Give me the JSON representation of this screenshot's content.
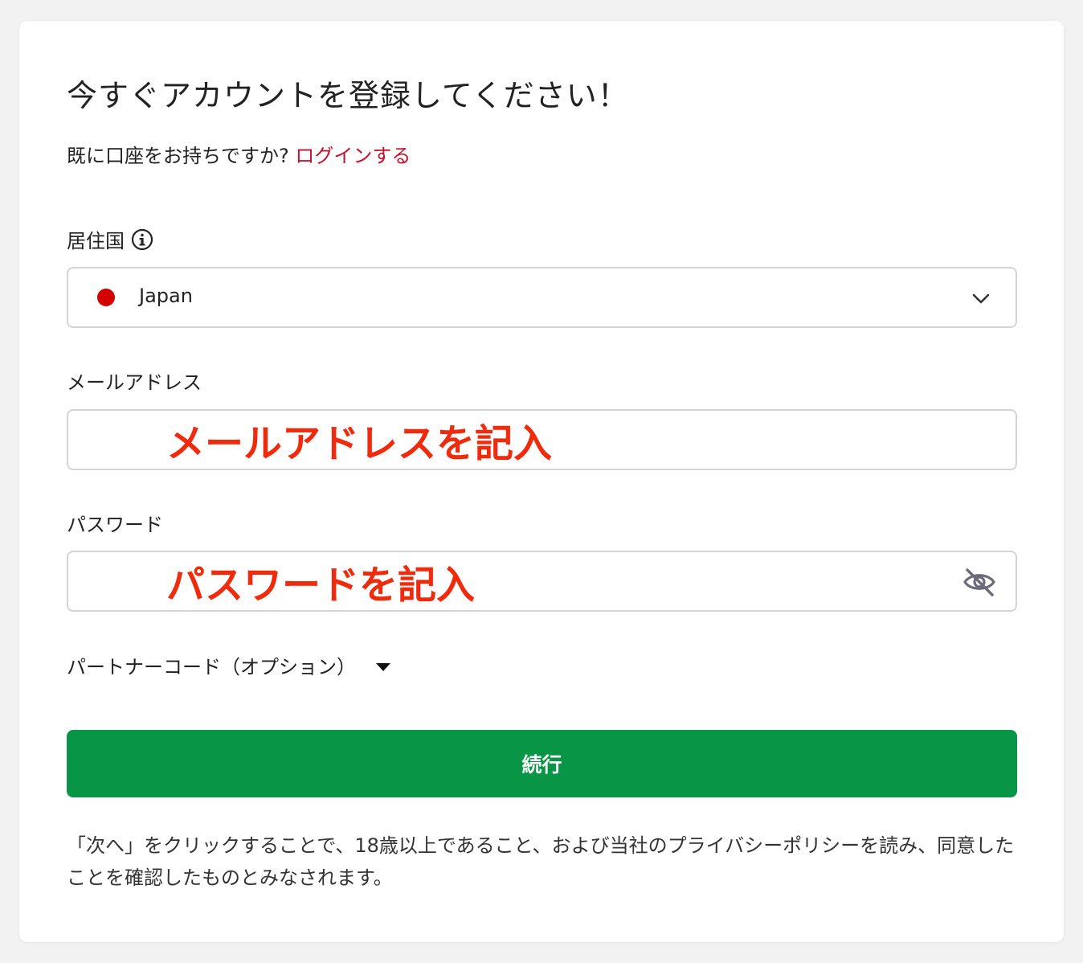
{
  "form": {
    "title": "今すぐアカウントを登録してください！",
    "login_prompt": "既に口座をお持ちですか? ",
    "login_link": "ログインする"
  },
  "country": {
    "label": "居住国",
    "value": "Japan",
    "flag_color": "#d30000",
    "icon": "info-icon"
  },
  "email": {
    "label": "メールアドレス",
    "value": "メールアドレスを記入"
  },
  "password": {
    "label": "パスワード",
    "value": "パスワードを記入",
    "icon": "eye-slash-icon"
  },
  "partner": {
    "label": "パートナーコード（オプション）",
    "icon": "caret-down-icon"
  },
  "continue_button": {
    "label": "続行",
    "color": "#089545"
  },
  "disclaimer": "「次へ」をクリックすることで、18歳以上であること、および当社のプライバシーポリシーを読み、同意したことを確認したものとみなされます。",
  "colors": {
    "link": "#c8102e",
    "annotation": "#f02a0c"
  }
}
